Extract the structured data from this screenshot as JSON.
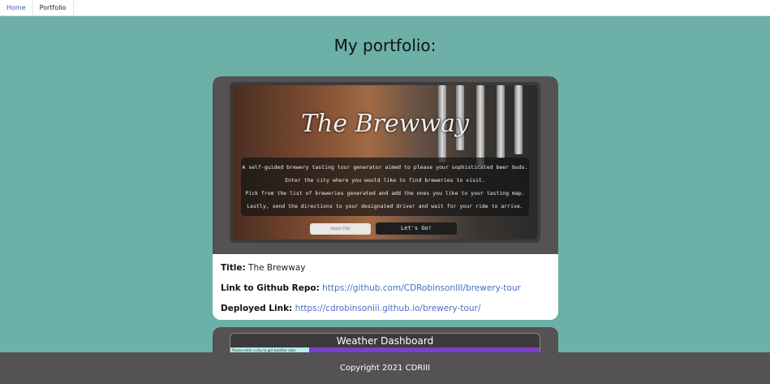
{
  "nav": {
    "home_label": "Home",
    "portfolio_label": "Portfolio"
  },
  "page": {
    "title": "My portfolio:"
  },
  "projects": [
    {
      "screenshot": {
        "app_title": "The Brewway",
        "lines": [
          "A self-guided brewery tasting tour generator aimed to please your sophisticated beer buds.",
          "Enter the city where you would like to find breweries to visit.",
          "Pick from the list of breweries generated and add the ones you like to your tasting map.",
          "Lastly, send the directions to your designated driver and wait for your ride to arrive."
        ],
        "input_placeholder": "Input City",
        "button_label": "Let's Go!"
      },
      "title_label": "Title:",
      "title": "The Brewway",
      "repo_label": "Link to Github Repo:",
      "repo_url": "https://github.com/CDRobinsonIII/brewery-tour",
      "deployed_label": "Deployed Link:",
      "deployed_url": "https://cdrobinsoniii.github.io/brewery-tour/"
    },
    {
      "screenshot": {
        "app_title": "Weather Dashboard",
        "input_placeholder": "Please enter a city to get weather data"
      }
    }
  ],
  "footer": {
    "text": "Copyright 2021 CDRIII"
  },
  "colors": {
    "background": "#6cb0a8",
    "card_frame": "#545253",
    "footer": "#545253",
    "link": "#4a6fc0"
  }
}
